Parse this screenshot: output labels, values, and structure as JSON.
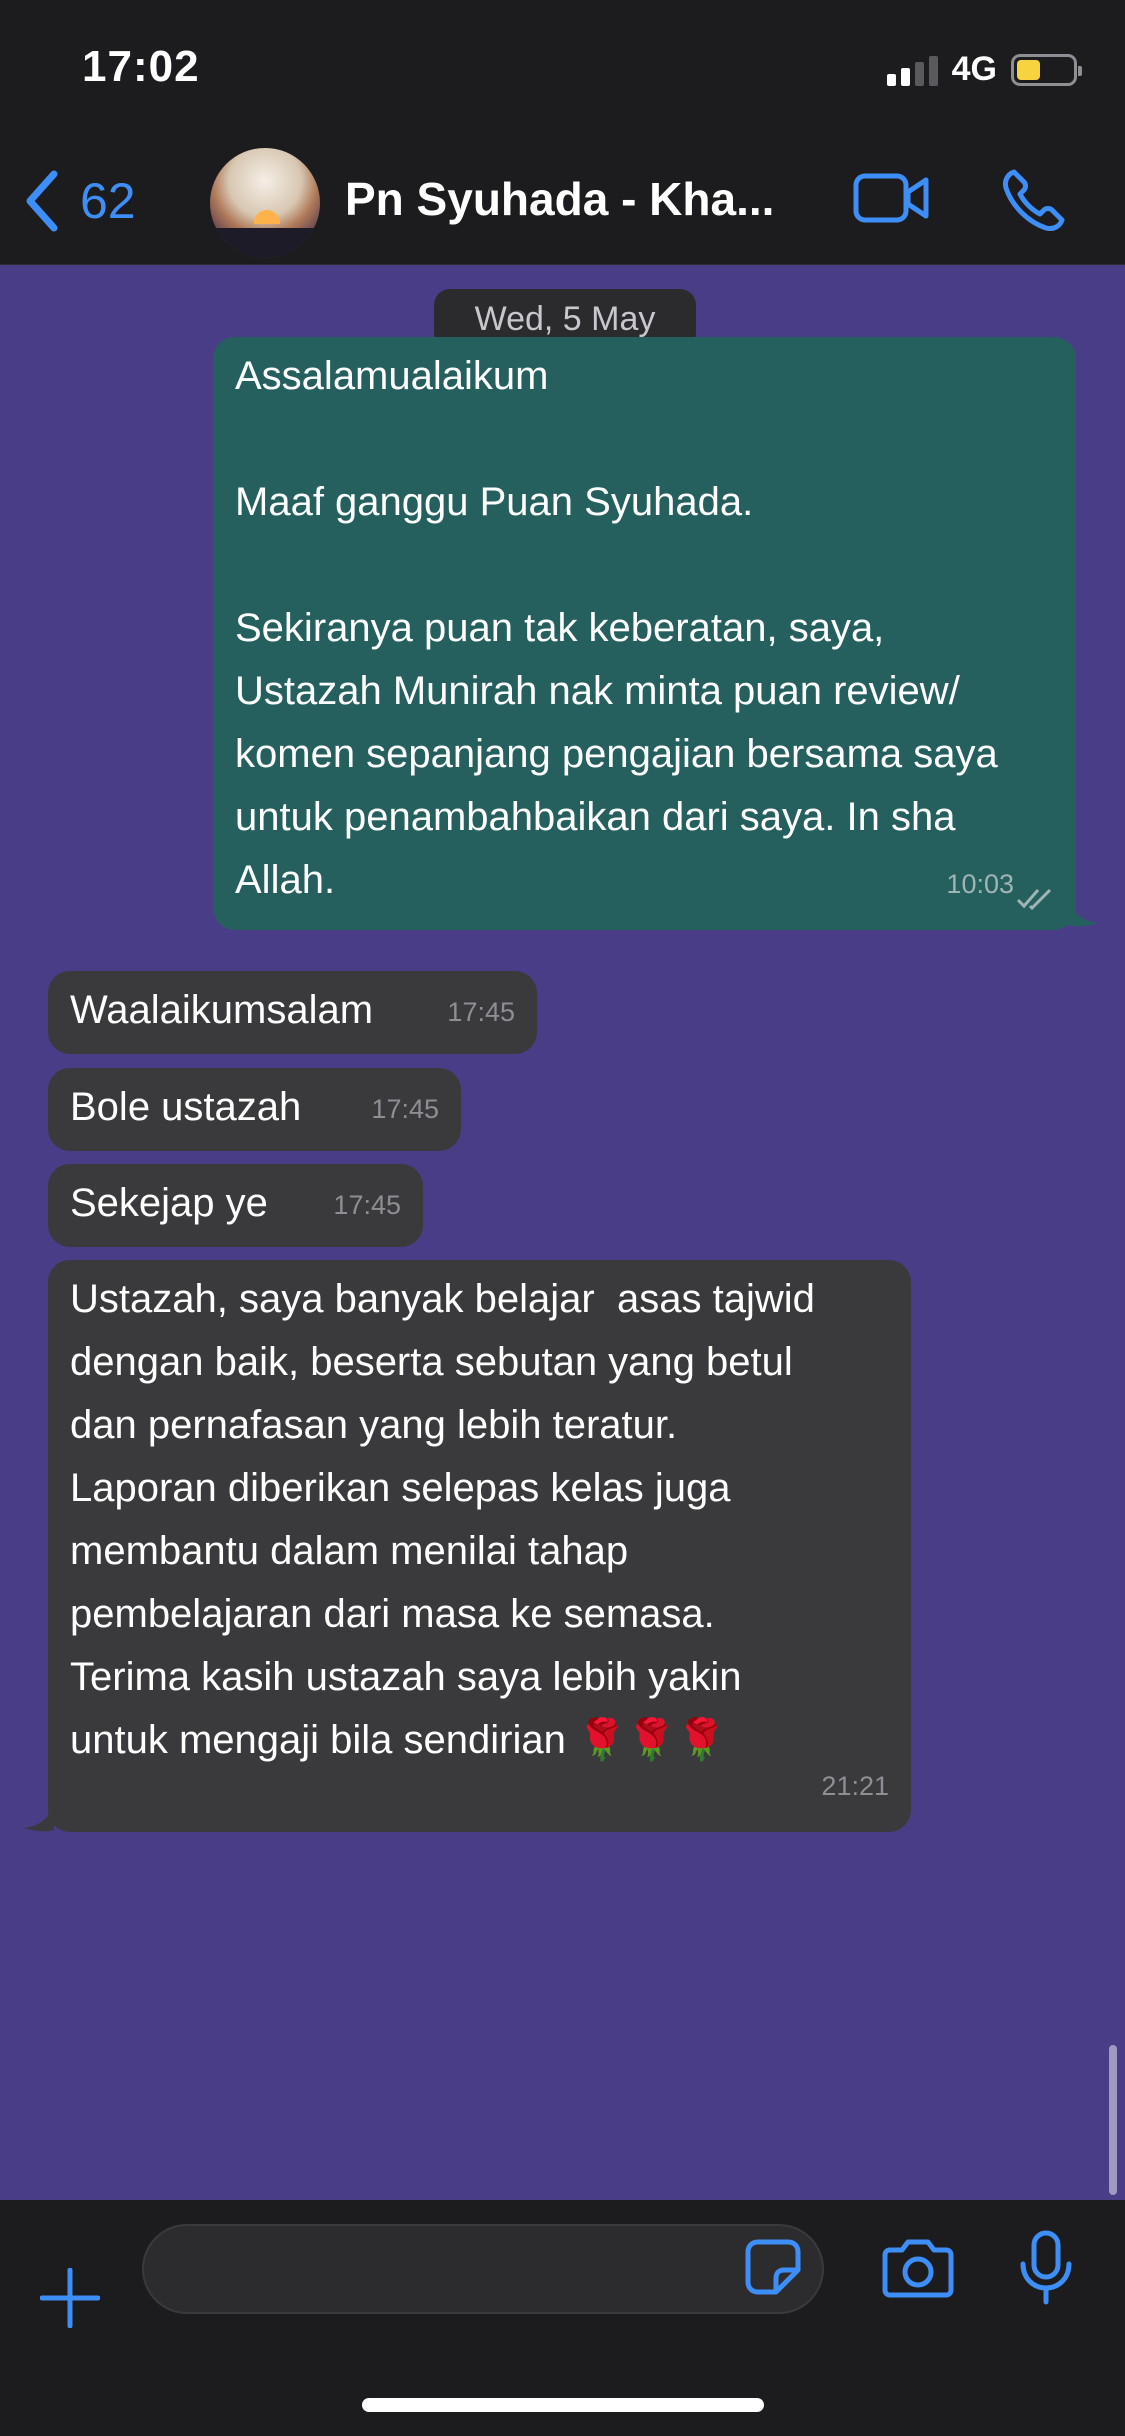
{
  "status_bar": {
    "time": "17:02",
    "network": "4G",
    "signal_bars_active": 2,
    "battery_level": 0.35
  },
  "header": {
    "back_count": "62",
    "contact_name": "Pn Syuhada - Kha...",
    "icons": [
      "back-chevron-icon",
      "video-call-icon",
      "phone-icon"
    ]
  },
  "chat": {
    "background_color": "#4a3d88",
    "date_separator": "Wed, 5 May",
    "messages": [
      {
        "direction": "outgoing",
        "text": "Assalamualaikum\n\nMaaf ganggu Puan Syuhada.\n\nSekiranya puan tak keberatan, saya,\nUstazah Munirah nak minta puan review/\nkomen sepanjang pengajian bersama saya\nuntuk penambahbaikan dari saya. In sha\nAllah.",
        "time": "10:03",
        "status": "read"
      },
      {
        "direction": "incoming",
        "text": "Waalaikumsalam",
        "time": "17:45"
      },
      {
        "direction": "incoming",
        "text": "Bole ustazah",
        "time": "17:45"
      },
      {
        "direction": "incoming",
        "text": "Sekejap ye",
        "time": "17:45"
      },
      {
        "direction": "incoming",
        "text": "Ustazah, saya banyak belajar  asas tajwid\ndengan baik, beserta sebutan yang betul\ndan pernafasan yang lebih teratur.\nLaporan diberikan selepas kelas juga\nmembantu dalam menilai tahap\npembelajaran dari masa ke semasa.\nTerima kasih ustazah saya lebih yakin\nuntuk mengaji bila sendirian 🌹🌹🌹",
        "time": "21:21"
      }
    ]
  },
  "input": {
    "value": "",
    "placeholder": "",
    "icons": [
      "plus-icon",
      "sticker-icon",
      "camera-icon",
      "microphone-icon"
    ]
  },
  "colors": {
    "accent": "#3e8ef7",
    "outgoing_bubble": "#25605f",
    "incoming_bubble": "#3a3a3c"
  }
}
